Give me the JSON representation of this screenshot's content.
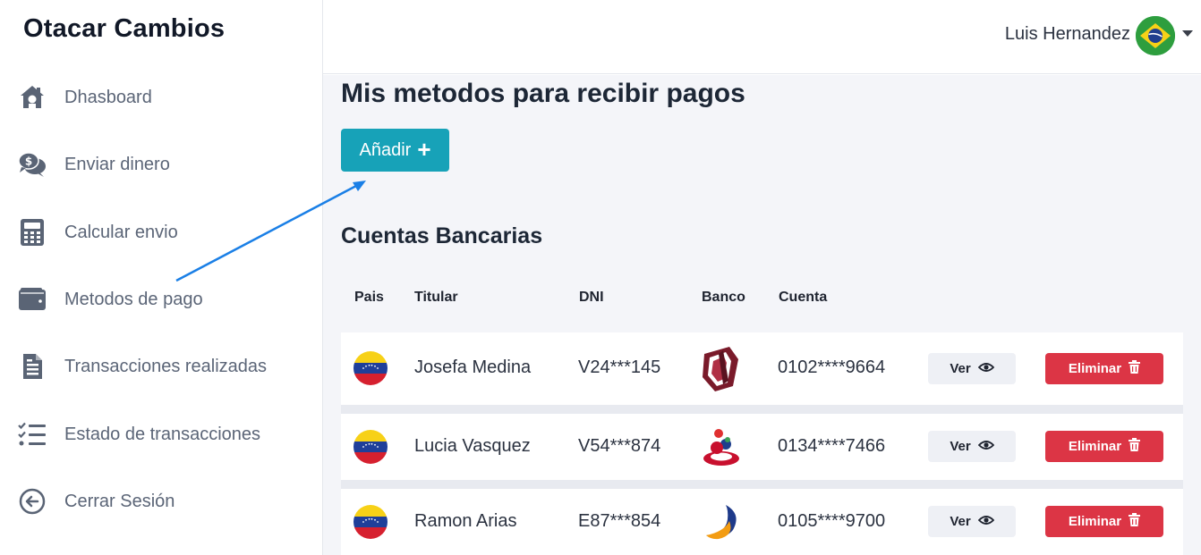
{
  "app": {
    "brand": "Otacar Cambios"
  },
  "sidebar": {
    "items": [
      {
        "label": "Dhasboard",
        "icon": "home-dollar-icon"
      },
      {
        "label": "Enviar dinero",
        "icon": "chat-dollar-icon"
      },
      {
        "label": "Calcular envio",
        "icon": "calculator-icon"
      },
      {
        "label": "Metodos de pago",
        "icon": "wallet-icon"
      },
      {
        "label": "Transacciones realizadas",
        "icon": "receipt-icon"
      },
      {
        "label": "Estado de transacciones",
        "icon": "checklist-icon"
      },
      {
        "label": "Cerrar Sesión",
        "icon": "logout-arrow-icon"
      }
    ]
  },
  "header": {
    "user_name": "Luis Hernandez",
    "user_flag": "brazil-flag-icon"
  },
  "main": {
    "title": "Mis metodos para recibir pagos",
    "add_button": "Añadir",
    "section_title": "Cuentas Bancarias",
    "columns": [
      "Pais",
      "Titular",
      "DNI",
      "Banco",
      "Cuenta"
    ],
    "rows": [
      {
        "pais": "venezuela-flag-icon",
        "titular": "Josefa Medina",
        "dni": "V24***145",
        "banco": "bank-logo-venezuela-icon",
        "cuenta": "0102****9664",
        "ver": "Ver",
        "eliminar": "Eliminar"
      },
      {
        "pais": "venezuela-flag-icon",
        "titular": "Lucia Vasquez",
        "dni": "V54***874",
        "banco": "bank-logo-bicentenario-icon",
        "cuenta": "0134****7466",
        "ver": "Ver",
        "eliminar": "Eliminar"
      },
      {
        "pais": "venezuela-flag-icon",
        "titular": "Ramon Arias",
        "dni": "E87***854",
        "banco": "bank-logo-mercantil-icon",
        "cuenta": "0105****9700",
        "ver": "Ver",
        "eliminar": "Eliminar"
      }
    ]
  },
  "colors": {
    "accent": "#17a2b8",
    "danger": "#dc3545",
    "annotation_arrow": "#1a7fe6",
    "background": "#f4f5f9"
  }
}
